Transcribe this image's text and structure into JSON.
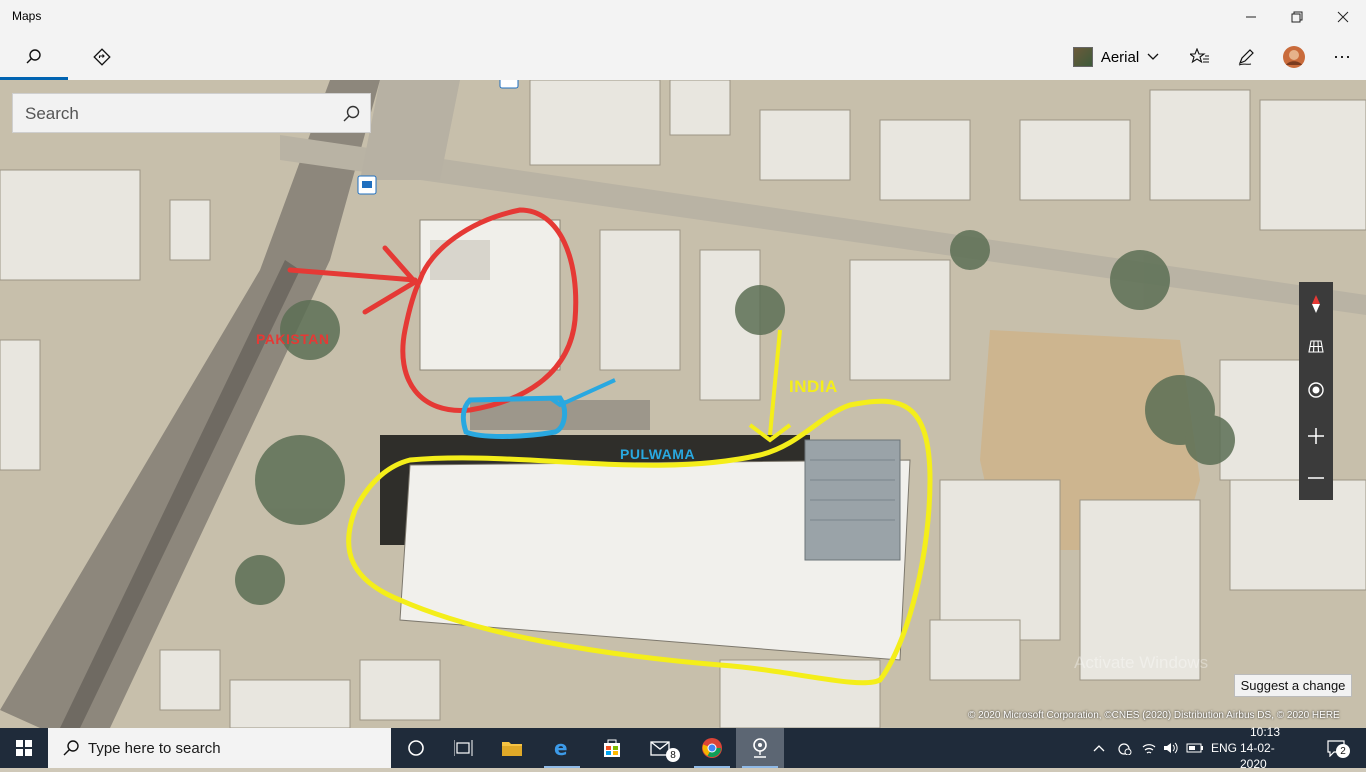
{
  "window": {
    "title": "Maps"
  },
  "toolbar": {
    "tabs": [
      {
        "name": "search",
        "icon": "search-icon",
        "active": true
      },
      {
        "name": "directions",
        "icon": "directions-icon",
        "active": false
      }
    ],
    "map_style": "Aerial",
    "icons": [
      "favorites-icon",
      "ink-pen-icon",
      "account-avatar",
      "more-icon"
    ]
  },
  "search": {
    "placeholder": "Search",
    "value": ""
  },
  "annotations": {
    "pakistan": "PAKISTAN",
    "pulwama": "PULWAMA",
    "india": "INDIA"
  },
  "annotation_colors": {
    "pakistan": "#e53935",
    "pulwama": "#29a8e0",
    "india": "#f4ee1a"
  },
  "map_controls": [
    "compass-icon",
    "3d-cities-icon",
    "my-location-icon",
    "zoom-in-icon",
    "zoom-out-icon"
  ],
  "footer": {
    "suggest_label": "Suggest a change",
    "copyright": "© 2020 Microsoft Corporation, ©CNES (2020) Distribution Airbus DS, © 2020 HERE",
    "watermark": "Activate Windows"
  },
  "taskbar": {
    "search_placeholder": "Type here to search",
    "mail_badge": "8",
    "language": "ENG",
    "time": "10:13",
    "date": "14-02-2020",
    "notification_count": "2"
  }
}
